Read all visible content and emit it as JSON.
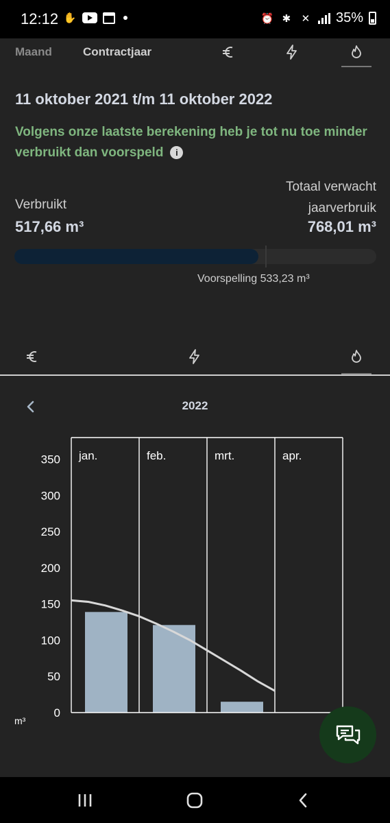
{
  "status_bar": {
    "time": "12:12",
    "battery": "35%"
  },
  "top_tabs": {
    "maand": "Maand",
    "contractjaar": "Contractjaar"
  },
  "period": {
    "title": "11 oktober 2021 t/m 11 oktober 2022"
  },
  "notice": {
    "text": "Volgens onze laatste berekening heb je tot nu toe minder verbruikt dan voorspeld"
  },
  "usage": {
    "used_label": "Verbruikt",
    "used_value": "517,66 m³",
    "expected_label": "Totaal verwacht jaarverbruik",
    "expected_value": "768,01 m³",
    "forecast_label": "Voorspelling 533,23 m³",
    "progress_fraction": 0.674,
    "forecast_fraction": 0.694
  },
  "chart_header": {
    "year": "2022"
  },
  "chart_data": {
    "type": "bar",
    "categories": [
      "jan.",
      "feb.",
      "mrt.",
      "apr."
    ],
    "values": [
      139,
      121,
      15,
      null
    ],
    "line": [
      155,
      153,
      148,
      141,
      133,
      123,
      112,
      100,
      86,
      72,
      58,
      43,
      30
    ],
    "yticks": [
      0,
      50,
      100,
      150,
      200,
      250,
      300,
      350
    ],
    "ylim": [
      0,
      380
    ],
    "ylabel": "m³",
    "bar_color": "#9fb3c4",
    "line_color": "#d8d8d8"
  },
  "colors": {
    "accent_green": "#7fb67f",
    "fab": "#153a1b",
    "progress": "#0d2236"
  }
}
